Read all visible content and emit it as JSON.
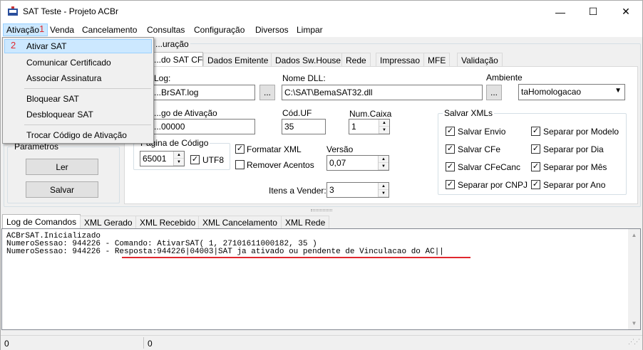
{
  "window": {
    "title": "SAT Teste - Projeto ACBr",
    "min": "—",
    "max": "☐",
    "close": "✕"
  },
  "menu": [
    "Ativação",
    "Venda",
    "Cancelamento",
    "Consultas",
    "Configuração",
    "Diversos",
    "Limpar"
  ],
  "annotations": {
    "one": "1",
    "two": "2"
  },
  "dropdown": [
    "Ativar SAT",
    "Comunicar Certificado",
    "Associar Assinatura",
    "Bloquear SAT",
    "Desbloquear SAT",
    "Trocar  Código de Ativação"
  ],
  "config_group_label": "...uração",
  "params": {
    "label": "Parametros",
    "ler": "Ler",
    "salvar": "Salvar"
  },
  "tabs": [
    "...do SAT CFe",
    "Dados Emitente",
    "Dados Sw.House",
    "Rede",
    "Impressao",
    "MFE",
    "Validação"
  ],
  "fields": {
    "log_label": "Log:",
    "log_value": "...BrSAT.log",
    "dll_label": "Nome DLL:",
    "dll_value": "C:\\SAT\\BemaSAT32.dll",
    "ambiente_label": "Ambiente",
    "ambiente_value": "taHomologacao",
    "ativacao_label": "...go de Ativação",
    "ativacao_value": "...00000",
    "uf_label": "Cód.UF",
    "uf_value": "35",
    "caixa_label": "Num.Caixa",
    "caixa_value": "1",
    "pagina_label": "Página de Código",
    "pagina_value": "65001",
    "utf8": "UTF8",
    "formatar_xml": "Formatar XML",
    "remover_acentos": "Remover Acentos",
    "versao_label": "Versão",
    "versao_value": "0,07",
    "itens_label": "Itens a Vender:",
    "itens_value": "3",
    "browse": "..."
  },
  "salvar_xmls": {
    "label": "Salvar XMLs",
    "items": [
      "Salvar Envio",
      "Salvar CFe",
      "Salvar CFeCanc",
      "Separar por CNPJ",
      "Separar por Modelo",
      "Separar por Dia",
      "Separar por Mês",
      "Separar por Ano"
    ]
  },
  "log_tabs": [
    "Log de Comandos",
    "XML Gerado",
    "XML Recebido",
    "XML Cancelamento",
    "XML Rede"
  ],
  "log_lines": [
    "ACBrSAT.Inicializado",
    "NumeroSessao: 944226 - Comando: AtivarSAT( 1, 27101611000182, 35 )",
    "NumeroSessao: 944226 - Resposta:944226|04003|SAT ja ativado ou pendente de Vinculacao do AC||"
  ],
  "status": {
    "left": "0",
    "right": "0"
  },
  "colors": {
    "annotation_red": "#e0282e",
    "menu_highlight": "#cce8ff"
  }
}
